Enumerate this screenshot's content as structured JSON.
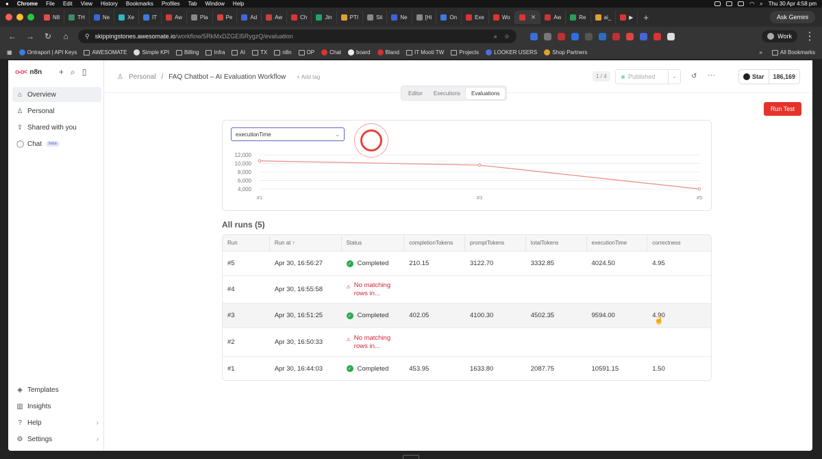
{
  "menubar": {
    "app": "Chrome",
    "items": [
      "File",
      "Edit",
      "View",
      "History",
      "Bookmarks",
      "Profiles",
      "Tab",
      "Window",
      "Help"
    ],
    "clock": "Thu 30 Apr  4:58 pm"
  },
  "tabs": [
    {
      "label": "N8"
    },
    {
      "label": "TH"
    },
    {
      "label": "Ne"
    },
    {
      "label": "Xe"
    },
    {
      "label": "IT"
    },
    {
      "label": "Aw"
    },
    {
      "label": "Pla"
    },
    {
      "label": "Pe"
    },
    {
      "label": "Ad"
    },
    {
      "label": "Aw"
    },
    {
      "label": "Ch"
    },
    {
      "label": "Jin"
    },
    {
      "label": "PTI"
    },
    {
      "label": "Sti"
    },
    {
      "label": "Ne"
    },
    {
      "label": "[Hi"
    },
    {
      "label": "On"
    },
    {
      "label": "Exe"
    },
    {
      "label": "Wo"
    },
    {
      "label": "",
      "active": true
    },
    {
      "label": "Aw"
    },
    {
      "label": "Re"
    },
    {
      "label": "ai_"
    },
    {
      "label": "▶"
    }
  ],
  "gemini": "Ask Gemini",
  "omnibox": {
    "host": "skippingstones.awesomate.io",
    "path": "/workflow/5RkMxDZGEI5RygzQ/evaluation"
  },
  "profile": "Work",
  "bookmarks": [
    "Ontraport | API Keys",
    "AWESOMATE",
    "Simple KPI",
    "Billing",
    "Infra",
    "AI",
    "TX",
    "n8n",
    "OP",
    "Chat",
    "board",
    "Bland",
    "IT Mooti TW",
    "Projects",
    "LOOKER USERS",
    "Shop Partners"
  ],
  "all_bookmarks": "All Bookmarks",
  "sidebar": {
    "brand": "n8n",
    "nav": [
      "Overview",
      "Personal",
      "Shared with you",
      "Chat"
    ],
    "beta": "beta",
    "bottom": [
      "Templates",
      "Insights",
      "Help",
      "Settings"
    ]
  },
  "header": {
    "project": "Personal",
    "workflow": "FAQ Chatbot – AI Evaluation Workflow",
    "add_tag": "+ Add tag",
    "pager": "1 / 4",
    "published": "Published",
    "star": "Star",
    "star_count": "186,169"
  },
  "tabs_seg": [
    "Editor",
    "Executions",
    "Evaluations"
  ],
  "run_test": "Run Test",
  "metric_select": "executionTime",
  "chart_data": {
    "type": "line",
    "categories": [
      "#1",
      "#2",
      "#3",
      "#4",
      "#5"
    ],
    "series": [
      {
        "values": [
          10591.15,
          null,
          9594.0,
          null,
          4024.5
        ]
      }
    ],
    "y_ticks": [
      "12,000",
      "10,000",
      "8,000",
      "6,000",
      "4,000"
    ],
    "x_tick_labels": [
      "#1",
      "#3",
      "#5"
    ],
    "ylim": [
      4000,
      12000
    ],
    "color": "#e98a85"
  },
  "all_runs": "All runs (5)",
  "table": {
    "columns": [
      "Run",
      "Run at ↑",
      "Status",
      "completionTokens",
      "promptTokens",
      "totalTokens",
      "executionTime",
      "correctness"
    ],
    "rows": [
      [
        "#5",
        "Apr 30, 16:56:27",
        "Completed",
        "210.15",
        "3122.70",
        "3332.85",
        "4024.50",
        "4.95"
      ],
      [
        "#4",
        "Apr 30, 16:55:58",
        "No matching rows in...",
        "",
        "",
        "",
        "",
        ""
      ],
      [
        "#3",
        "Apr 30, 16:51:25",
        "Completed",
        "402.05",
        "4100.30",
        "4502.35",
        "9594.00",
        "4.90"
      ],
      [
        "#2",
        "Apr 30, 16:50:33",
        "No matching rows in...",
        "",
        "",
        "",
        "",
        ""
      ],
      [
        "#1",
        "Apr 30, 16:44:03",
        "Completed",
        "453.95",
        "1633.80",
        "2087.75",
        "10591.15",
        "1.50"
      ]
    ]
  }
}
